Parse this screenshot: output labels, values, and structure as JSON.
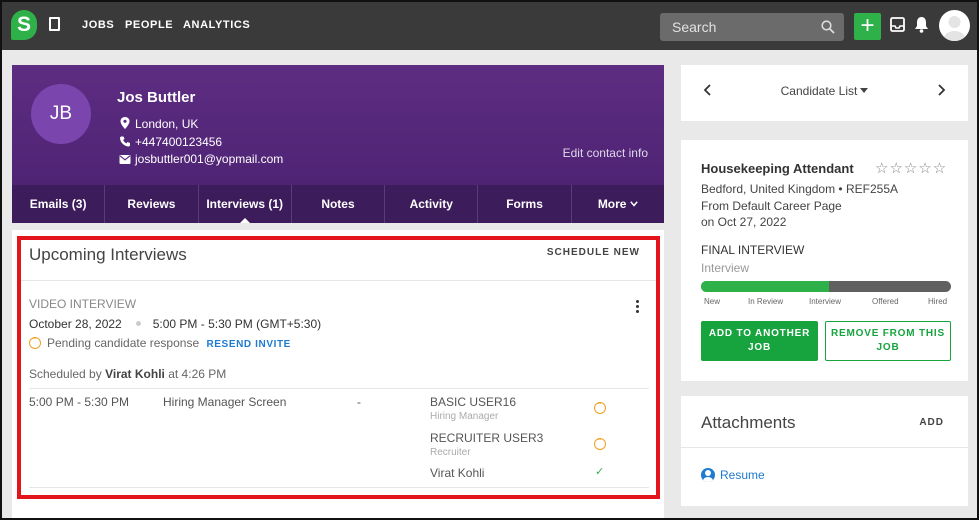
{
  "nav": {
    "logo_letter": "S",
    "links": [
      "JOBS",
      "PEOPLE",
      "ANALYTICS"
    ],
    "search_placeholder": "Search",
    "plus_label": "+"
  },
  "candidate": {
    "initials": "JB",
    "name": "Jos Buttler",
    "location": "London, UK",
    "phone": "+447400123456",
    "email": "josbuttler001@yopmail.com",
    "edit_contact": "Edit contact info",
    "tabs": [
      "Emails (3)",
      "Reviews",
      "Interviews (1)",
      "Notes",
      "Activity",
      "Forms",
      "More"
    ],
    "active_tab": "Interviews (1)"
  },
  "interviews": {
    "title": "Upcoming Interviews",
    "schedule_new": "SCHEDULE NEW",
    "type": "VIDEO INTERVIEW",
    "date": "October 28, 2022",
    "time": "5:00 PM - 5:30 PM (GMT+5:30)",
    "pending": "Pending candidate response",
    "resend": "RESEND INVITE",
    "scheduled_prefix": "Scheduled by",
    "scheduled_by": "Virat Kohli",
    "scheduled_suffix": "at 4:26 PM",
    "slot": {
      "time": "5:00 PM - 5:30 PM",
      "name": "Hiring Manager Screen",
      "location": "-",
      "participants": [
        {
          "name": "BASIC USER16",
          "role": "Hiring Manager",
          "status": "pending"
        },
        {
          "name": "RECRUITER USER3",
          "role": "Recruiter",
          "status": "pending"
        },
        {
          "name": "Virat Kohli",
          "role": "",
          "status": "accepted"
        }
      ]
    }
  },
  "list_nav": {
    "label": "Candidate List",
    "prev": "‹",
    "next": "›"
  },
  "job": {
    "title": "Housekeeping Attendant",
    "location": "Bedford, United Kingdom",
    "ref": "REF255A",
    "source": "From Default Career Page",
    "date": "on Oct 27, 2022",
    "stage": "FINAL INTERVIEW",
    "sub_stage": "Interview",
    "pipeline": [
      "New",
      "In Review",
      "Interview",
      "Offered",
      "Hired"
    ],
    "progress": 0.51,
    "rating": 0,
    "add_button": "ADD TO ANOTHER JOB",
    "remove_button": "REMOVE FROM THIS JOB"
  },
  "attachments": {
    "title": "Attachments",
    "add": "ADD",
    "file": "Resume"
  },
  "colors": {
    "brand_green": "#2fb14a",
    "header_purple": "#5d2d82",
    "highlight_red": "#e3141c",
    "link_blue": "#1e7ad2"
  }
}
